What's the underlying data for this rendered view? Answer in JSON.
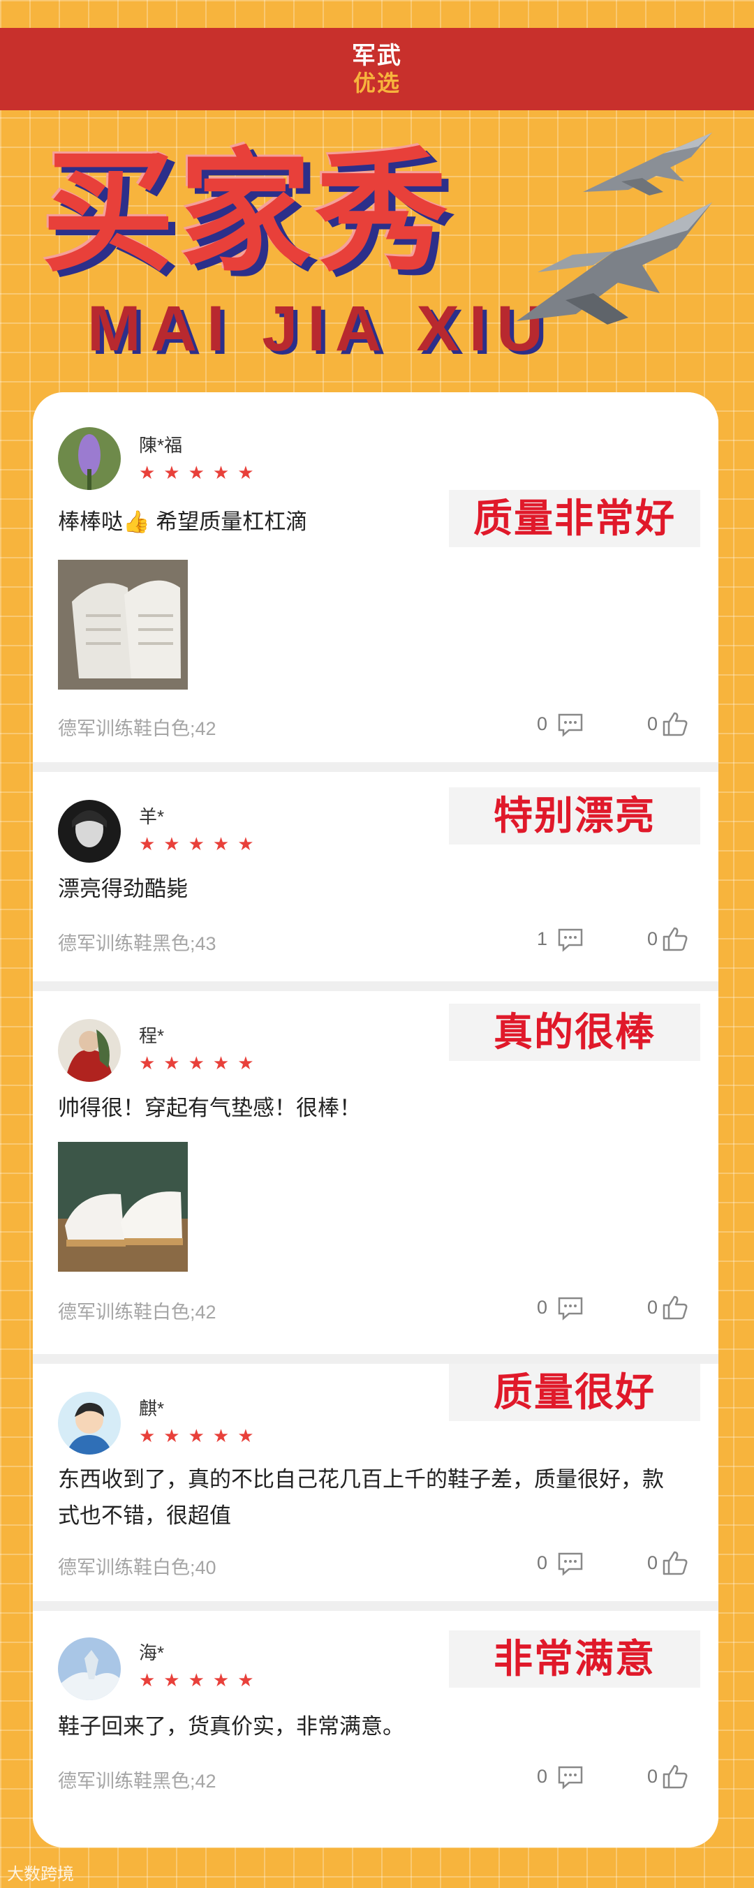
{
  "brand": {
    "line1": "军武",
    "line2": "优选"
  },
  "hero": {
    "title": "买家秀",
    "subtitle": "MAI JIA XIU"
  },
  "reviews": [
    {
      "user": "陳*福",
      "stars": "★★★★★",
      "badge": "质量非常好",
      "text": "棒棒哒👍 希望质量杠杠滴",
      "product": "德军训练鞋白色;42",
      "comments": "0",
      "likes": "0"
    },
    {
      "user": "羊*",
      "stars": "★★★★★",
      "badge": "特别漂亮",
      "text": "漂亮得劲酷毙",
      "product": "德军训练鞋黑色;43",
      "comments": "1",
      "likes": "0"
    },
    {
      "user": "程*",
      "stars": "★★★★★",
      "badge": "真的很棒",
      "text": "帅得很！穿起有气垫感！很棒！",
      "product": "德军训练鞋白色;42",
      "comments": "0",
      "likes": "0"
    },
    {
      "user": "麒*",
      "stars": "★★★★★",
      "badge": "质量很好",
      "text": "东西收到了，真的不比自己花几百上千的鞋子差，质量很好，款式也不错，很超值",
      "product": "德军训练鞋白色;40",
      "comments": "0",
      "likes": "0"
    },
    {
      "user": "海*",
      "stars": "★★★★★",
      "badge": "非常满意",
      "text": "鞋子回来了，货真价实，非常满意。",
      "product": "德军训练鞋黑色;42",
      "comments": "0",
      "likes": "0"
    }
  ],
  "watermark": "大数跨境",
  "colors": {
    "accent": "#e0192a",
    "header": "#c8302c",
    "background": "#f7b43d",
    "star": "#e8403a"
  },
  "icons": {
    "comment": "comment-icon",
    "like": "thumbs-up-icon"
  }
}
